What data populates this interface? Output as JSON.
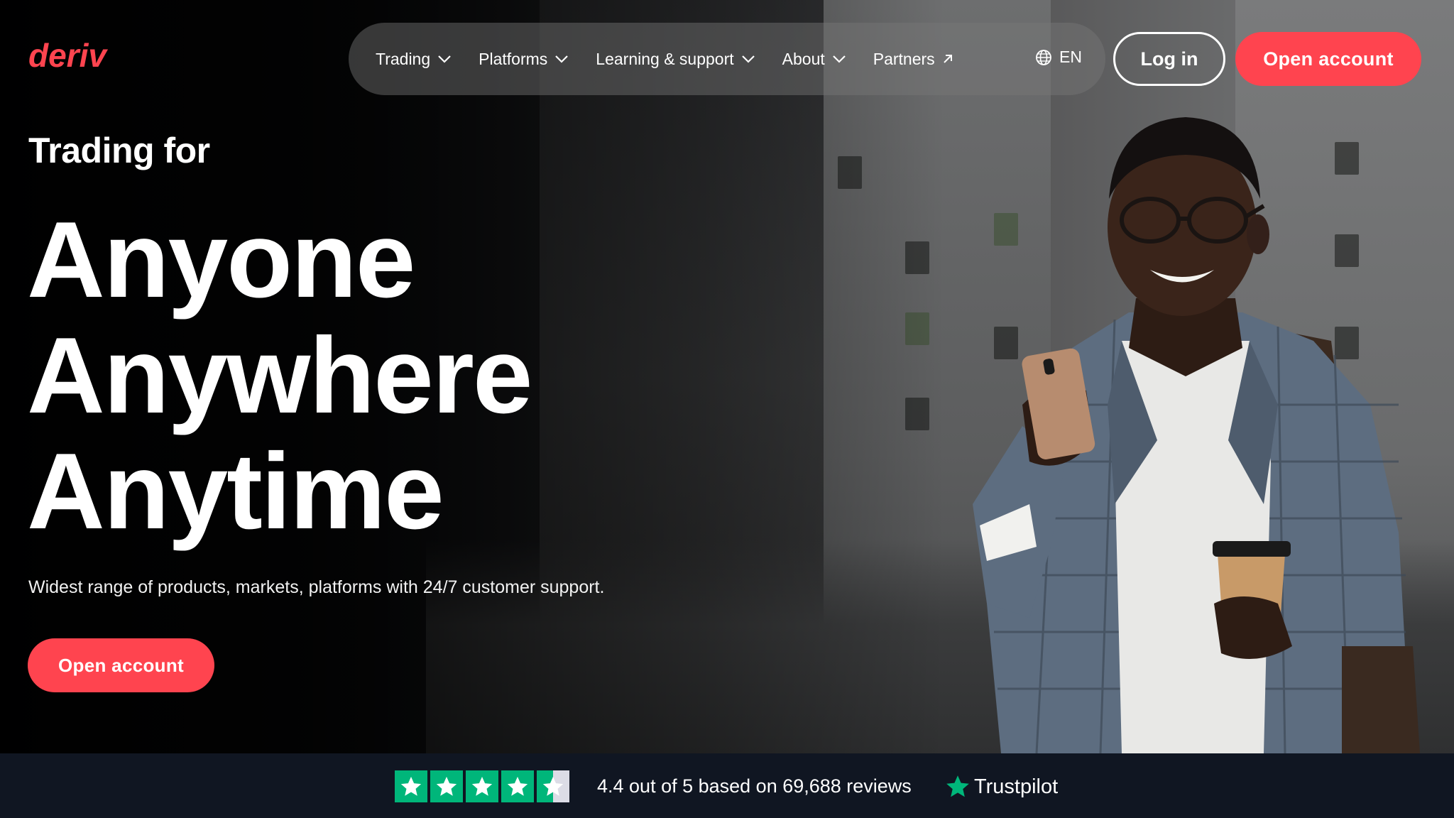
{
  "header": {
    "logo_text": "deriv",
    "nav": [
      {
        "label": "Trading",
        "icon": "chevron-down-icon"
      },
      {
        "label": "Platforms",
        "icon": "chevron-down-icon"
      },
      {
        "label": "Learning & support",
        "icon": "chevron-down-icon"
      },
      {
        "label": "About",
        "icon": "chevron-down-icon"
      },
      {
        "label": "Partners",
        "icon": "arrow-up-right-icon"
      }
    ],
    "language": "EN",
    "login_label": "Log in",
    "open_account_label": "Open account"
  },
  "hero": {
    "eyebrow": "Trading for",
    "headline": [
      "Anyone",
      "Anywhere",
      "Anytime"
    ],
    "subtext": "Widest range of products, markets, platforms with 24/7 customer support.",
    "cta_label": "Open account"
  },
  "trust": {
    "rating": 4.4,
    "stars_filled": 4.5,
    "stars_total": 5,
    "text": "4.4 out of 5 based on 69,688 reviews",
    "brand": "Trustpilot"
  },
  "colors": {
    "brand_red": "#ff444f",
    "trust_green": "#00b67a",
    "trust_bar_bg": "#101622"
  }
}
